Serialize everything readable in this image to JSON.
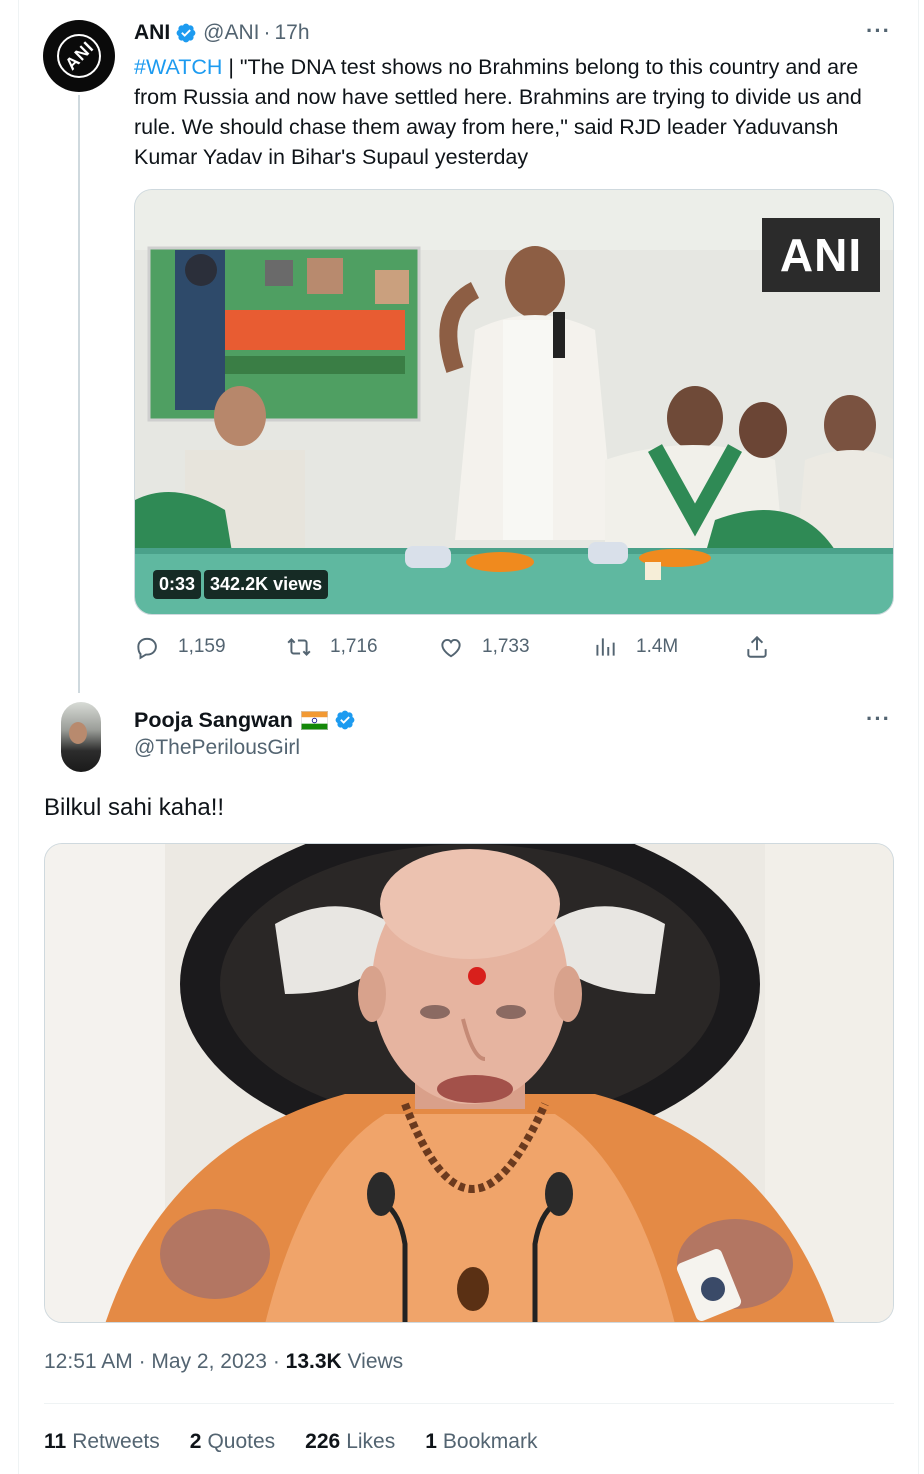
{
  "tweet1": {
    "avatar_text": "ANI",
    "name": "ANI",
    "handle": "@ANI",
    "separator": "·",
    "time": "17h",
    "hashtag": "#WATCH",
    "body": " | \"The DNA test shows no Brahmins belong to this country and are from Russia and now have settled here. Brahmins are trying to divide us and rule. We should chase them away from here,\" said RJD leader Yaduvansh Kumar Yadav in Bihar's Supaul yesterday",
    "video": {
      "watermark": "ANI",
      "duration": "0:33",
      "views": "342.2K views"
    },
    "actions": {
      "replies": "1,159",
      "retweets": "1,716",
      "likes": "1,733",
      "views": "1.4M"
    },
    "icons": [
      "verified-badge-icon",
      "more-icon",
      "reply-icon",
      "retweet-icon",
      "like-icon",
      "views-icon",
      "share-icon"
    ]
  },
  "tweet2": {
    "name": "Pooja Sangwan",
    "handle": "@ThePerilousGirl",
    "text": "Bilkul sahi kaha!!",
    "meta": {
      "time": "12:51 AM",
      "sep1": " · ",
      "date": "May 2, 2023",
      "sep2": " · ",
      "views_count": "13.3K",
      "views_label": " Views"
    },
    "stats": {
      "retweets_count": "11",
      "retweets_label": "Retweets",
      "quotes_count": "2",
      "quotes_label": "Quotes",
      "likes_count": "226",
      "likes_label": "Likes",
      "bookmarks_count": "1",
      "bookmarks_label": "Bookmark"
    },
    "icons": [
      "india-flag-icon",
      "verified-badge-icon",
      "more-icon"
    ]
  },
  "colors": {
    "text": "#0f1419",
    "secondary": "#536471",
    "accent": "#1d9bf0",
    "border": "#cfd9de"
  }
}
